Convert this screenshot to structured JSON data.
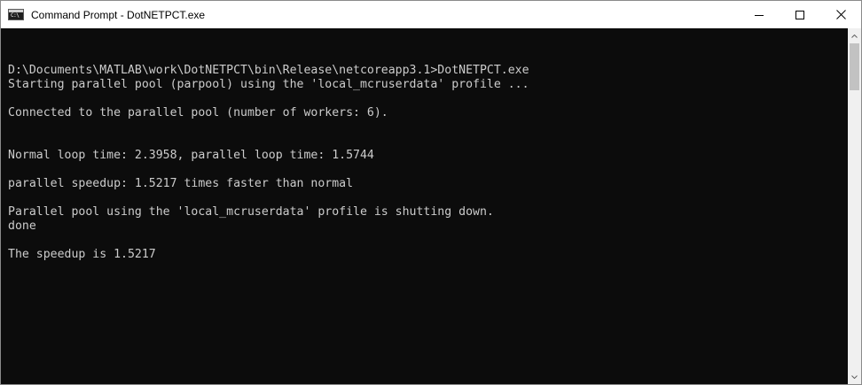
{
  "window": {
    "title": "Command Prompt - DotNETPCT.exe",
    "icon": "cmd-icon",
    "icon_glyph": "C:\\"
  },
  "caption": {
    "minimize_icon": "minimize-icon",
    "maximize_icon": "maximize-icon",
    "close_icon": "close-icon"
  },
  "console": {
    "text_color": "#cccccc",
    "background": "#0c0c0c",
    "lines": [
      "D:\\Documents\\MATLAB\\work\\DotNETPCT\\bin\\Release\\netcoreapp3.1>DotNETPCT.exe",
      "Starting parallel pool (parpool) using the 'local_mcruserdata' profile ...",
      "",
      "Connected to the parallel pool (number of workers: 6).",
      "",
      "",
      "Normal loop time: 2.3958, parallel loop time: 1.5744",
      "",
      "parallel speedup: 1.5217 times faster than normal",
      "",
      "Parallel pool using the 'local_mcruserdata' profile is shutting down.",
      "done",
      "",
      "The speedup is 1.5217"
    ]
  }
}
